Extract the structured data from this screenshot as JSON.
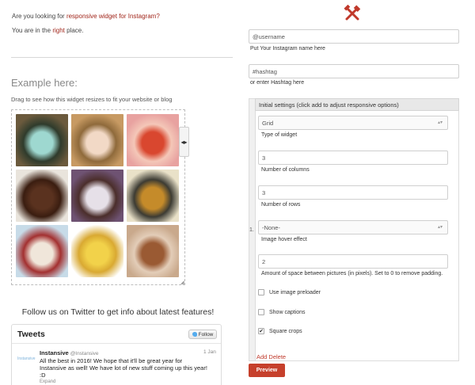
{
  "intro": {
    "line1_prefix": "Are you looking for ",
    "line1_highlight": "responsive widget for Instagram?",
    "line2_prefix": "You are in the ",
    "line2_highlight": "right",
    "line2_suffix": " place."
  },
  "example": {
    "title": "Example here:",
    "drag_note": "Drag to see how this widget resizes to fit your website or blog",
    "resize_arrows": "◂▸",
    "corner_grip": "◢",
    "photos": [
      {
        "desc": "mint cake with flowers",
        "colors": [
          "#6b5a3d",
          "#9ed8d0",
          "#2f3b2c"
        ]
      },
      {
        "desc": "pink iced cake",
        "colors": [
          "#c79a63",
          "#f2d9c6",
          "#8f6a3b"
        ]
      },
      {
        "desc": "red flower pastry",
        "colors": [
          "#e8a2a0",
          "#d9472f",
          "#f4c7b8"
        ]
      },
      {
        "desc": "brownie stack",
        "colors": [
          "#e9e4dc",
          "#5a321f",
          "#3a1d10"
        ]
      },
      {
        "desc": "chocolate cake with cream",
        "colors": [
          "#6e5272",
          "#e6e0e8",
          "#4b2e2b"
        ]
      },
      {
        "desc": "small bowls of sauces",
        "colors": [
          "#e9e1c8",
          "#c58b2a",
          "#3c3b33"
        ]
      },
      {
        "desc": "berry pavlova",
        "colors": [
          "#c7dbe8",
          "#f0e6da",
          "#a33030"
        ]
      },
      {
        "desc": "lemon tart",
        "colors": [
          "#ffffff",
          "#f2d24a",
          "#d9a932"
        ]
      },
      {
        "desc": "pastries on tray",
        "colors": [
          "#c9a98c",
          "#9a5a33",
          "#e3cdb8"
        ]
      }
    ]
  },
  "follow": {
    "text": "Follow us on Twitter to get info about latest features!"
  },
  "tweets": {
    "title": "Tweets",
    "follow_label": "Follow",
    "avatar_text": "Instansive",
    "author": "Instansive",
    "handle": "@Instansive",
    "date": "1 Jan",
    "text": "All the best in 2016! We hope that it'll be great year for Instansive as well! We have lot of new stuff coming up this year! :D",
    "expand": "Expand"
  },
  "form": {
    "username_placeholder": "@username",
    "username_help": "Put Your Instagram name here",
    "hashtag_placeholder": "#hashtag",
    "hashtag_help": "or enter Hashtag here",
    "settings_index": "1.",
    "settings_header": "Initial settings (click add to adjust responsive options)",
    "widget_type_value": "Grid",
    "widget_type_label": "Type of widget",
    "columns_value": "3",
    "columns_label": "Number of columns",
    "rows_value": "3",
    "rows_label": "Number of rows",
    "hover_value": "-None-",
    "hover_label": "Image hover effect",
    "spacing_value": "2",
    "spacing_label": "Amount of space between pictures (in pixels). Set to 0 to remove padding.",
    "preloader_label": "Use image preloader",
    "preloader_checked": false,
    "captions_label": "Show captions",
    "captions_checked": false,
    "square_label": "Square crops",
    "square_checked": true,
    "check_mark": "✔",
    "select_arrows": "▴▾",
    "add_delete": "Add Delete",
    "preview_label": "Preview"
  },
  "colors": {
    "accent": "#a1261b",
    "button": "#c6402c",
    "twitter": "#55acee"
  }
}
